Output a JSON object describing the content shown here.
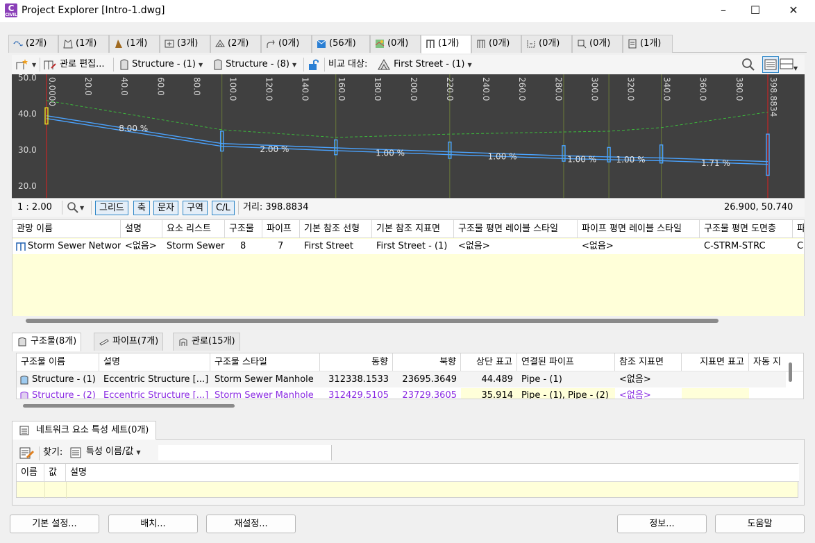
{
  "window": {
    "title": "Project Explorer [Intro-1.dwg]",
    "app_icon_letter": "C",
    "app_icon_sub": "CIVIL"
  },
  "main_tabs": [
    {
      "label": "(2개)",
      "icon": "alignment-icon"
    },
    {
      "label": "(1개)",
      "icon": "sites-icon"
    },
    {
      "label": "(1개)",
      "icon": "profile-icon"
    },
    {
      "label": "(3개)",
      "icon": "assembly-icon"
    },
    {
      "label": "(2개)",
      "icon": "surface-icon"
    },
    {
      "label": "(0개)",
      "icon": "pressure-pipe-icon"
    },
    {
      "label": "(56개)",
      "icon": "parcel-icon"
    },
    {
      "label": "(0개)",
      "icon": "map-icon"
    },
    {
      "label": "(1개)",
      "icon": "pipe-network-icon"
    },
    {
      "label": "(0개)",
      "icon": "pipe-network-2-icon"
    },
    {
      "label": "(0개)",
      "icon": "feature-line-icon"
    },
    {
      "label": "(0개)",
      "icon": "sample-line-icon"
    },
    {
      "label": "(1개)",
      "icon": "document-icon"
    }
  ],
  "toolbar": {
    "edit_network": "관로 편집...",
    "structure_1": "Structure - (1)",
    "structure_8": "Structure - (8)",
    "compare_label": "비교 대상:",
    "compare_value": "First Street - (1)"
  },
  "profile": {
    "y_labels": [
      "50.0",
      "40.0",
      "30.0",
      "20.0"
    ],
    "station_labels": [
      "0.0000",
      "20.0",
      "40.0",
      "60.0",
      "80.0",
      "100.0",
      "120.0",
      "140.0",
      "160.0",
      "180.0",
      "200.0",
      "220.0",
      "240.0",
      "260.0",
      "280.0",
      "300.0",
      "320.0",
      "340.0",
      "360.0",
      "380.0",
      "398.8834"
    ],
    "slope_labels": [
      "8.00 %",
      "2.00 %",
      "1.00 %",
      "1.00 %",
      "1.00 %",
      "1.00 %",
      "1.71 %"
    ],
    "colors": {
      "background": "#404040",
      "pipe": "#4aa3ff",
      "ground": "#3cba3c",
      "end_line": "#e02020"
    }
  },
  "profile_status": {
    "scale": "1 : 2.00",
    "toggles": [
      "그리드",
      "축",
      "문자",
      "구역",
      "C/L"
    ],
    "distance": "거리: 398.8834",
    "coords": "26.900, 50.740"
  },
  "network_grid": {
    "columns": [
      "관망 이름",
      "설명",
      "요소 리스트",
      "구조물",
      "파이프",
      "기본 참조 선형",
      "기본 참조 지표면",
      "구조물 평면 레이블 스타일",
      "파이프 평면 레이블 스타일",
      "구조물 평면 도면층",
      "파"
    ],
    "row": [
      "Storm Sewer Network",
      "<없음>",
      "Storm Sewer",
      "8",
      "7",
      "First Street",
      "First Street - (1)",
      "<없음>",
      "<없음>",
      "C-STRM-STRC",
      "C"
    ]
  },
  "sub_tabs": [
    "구조물(8개)",
    "파이프(7개)",
    "관로(15개)"
  ],
  "structure_grid": {
    "columns": [
      "구조물 이름",
      "설명",
      "구조물 스타일",
      "동향",
      "북향",
      "상단 표고",
      "연결된 파이프",
      "참조 지표면",
      "지표면 표고",
      "자동 지"
    ],
    "rows": [
      [
        "Structure - (1)",
        "Eccentric Structure  [...]",
        "Storm Sewer Manhole",
        "312338.1533",
        "23695.3649",
        "44.489",
        "Pipe - (1)",
        "<없음>",
        "",
        ""
      ],
      [
        "Structure - (2)",
        "Eccentric Structure  [...]",
        "Storm Sewer Manhole",
        "312429.5105",
        "23729.3605",
        "35.914",
        "Pipe - (1), Pipe - (2)",
        "<없음>",
        "",
        ""
      ]
    ]
  },
  "property_sets": {
    "tab_label": "네트워크 요소 특성 세트(0개)",
    "find_label": "찾기:",
    "find_mode": "특성 이름/값",
    "columns": [
      "이름",
      "값",
      "설명"
    ]
  },
  "buttons": {
    "basic_settings": "기본 설정...",
    "layout": "배치...",
    "reset": "재설정...",
    "info": "정보...",
    "help": "도움말"
  }
}
